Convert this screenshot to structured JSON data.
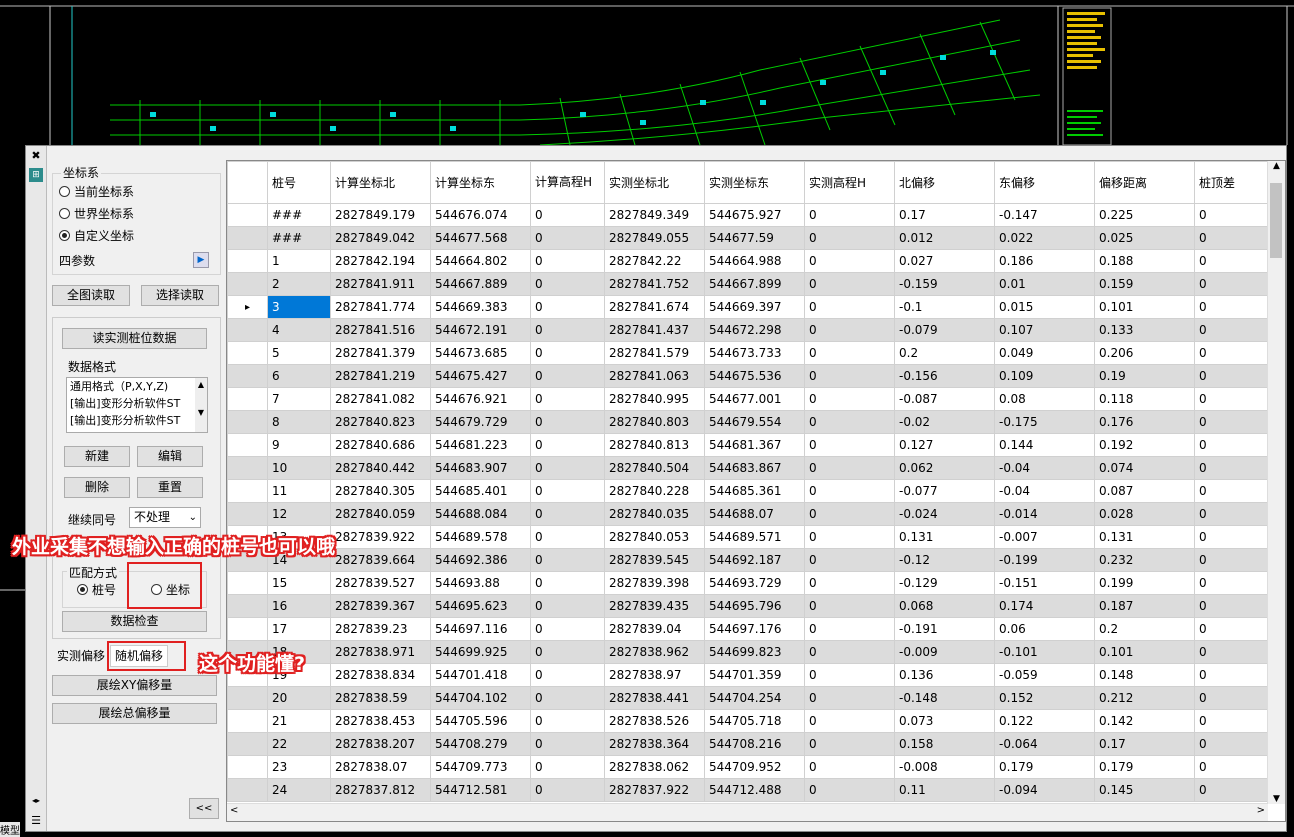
{
  "colors": {
    "accent_annotation": "#e02020",
    "selection": "#0078d7",
    "cad_bg": "#000000",
    "cad_green": "#00cc00"
  },
  "strip": {
    "close": "✖",
    "pin": "⊞",
    "bottom1": "◂▸",
    "bottom2": "☰"
  },
  "coord": {
    "title": "坐标系",
    "options": [
      "当前坐标系",
      "世界坐标系",
      "自定义坐标"
    ],
    "selected": 2,
    "params_label": "四参数"
  },
  "read": {
    "full": "全图读取",
    "select": "选择读取"
  },
  "measured_btn": "读实测桩位数据",
  "format": {
    "title": "数据格式",
    "items": [
      "通用格式（P,X,Y,Z)",
      "[输出]变形分析软件ST",
      "[输出]变形分析软件ST"
    ],
    "new": "新建",
    "edit": "编辑",
    "delete": "删除",
    "reset": "重置"
  },
  "continue": {
    "label": "继续同号",
    "value": "不处理"
  },
  "match": {
    "title": "匹配方式",
    "opt1": "桩号",
    "opt2": "坐标"
  },
  "check_btn": "数据检查",
  "tabs": [
    "实测偏移",
    "随机偏移"
  ],
  "draw_xy": "展绘XY偏移量",
  "draw_total": "展绘总偏移量",
  "collapse": "<<",
  "annotations": {
    "a1": "外业采集不想输入正确的桩号也可以哦",
    "a2": "这个功能懂?"
  },
  "bottom_label": "模型",
  "grid": {
    "headers": [
      "桩号",
      "计算坐标北",
      "计算坐标东",
      "计算高程H",
      "实测坐标北",
      "实测坐标东",
      "实测高程H",
      "北偏移",
      "东偏移",
      "偏移距离",
      "桩顶差"
    ],
    "selected_row": 3,
    "rows": [
      [
        "###",
        "2827849.179",
        "544676.074",
        "0",
        "2827849.349",
        "544675.927",
        "0",
        "0.17",
        "-0.147",
        "0.225",
        "0"
      ],
      [
        "###",
        "2827849.042",
        "544677.568",
        "0",
        "2827849.055",
        "544677.59",
        "0",
        "0.012",
        "0.022",
        "0.025",
        "0"
      ],
      [
        "1",
        "2827842.194",
        "544664.802",
        "0",
        "2827842.22",
        "544664.988",
        "0",
        "0.027",
        "0.186",
        "0.188",
        "0"
      ],
      [
        "2",
        "2827841.911",
        "544667.889",
        "0",
        "2827841.752",
        "544667.899",
        "0",
        "-0.159",
        "0.01",
        "0.159",
        "0"
      ],
      [
        "3",
        "2827841.774",
        "544669.383",
        "0",
        "2827841.674",
        "544669.397",
        "0",
        "-0.1",
        "0.015",
        "0.101",
        "0"
      ],
      [
        "4",
        "2827841.516",
        "544672.191",
        "0",
        "2827841.437",
        "544672.298",
        "0",
        "-0.079",
        "0.107",
        "0.133",
        "0"
      ],
      [
        "5",
        "2827841.379",
        "544673.685",
        "0",
        "2827841.579",
        "544673.733",
        "0",
        "0.2",
        "0.049",
        "0.206",
        "0"
      ],
      [
        "6",
        "2827841.219",
        "544675.427",
        "0",
        "2827841.063",
        "544675.536",
        "0",
        "-0.156",
        "0.109",
        "0.19",
        "0"
      ],
      [
        "7",
        "2827841.082",
        "544676.921",
        "0",
        "2827840.995",
        "544677.001",
        "0",
        "-0.087",
        "0.08",
        "0.118",
        "0"
      ],
      [
        "8",
        "2827840.823",
        "544679.729",
        "0",
        "2827840.803",
        "544679.554",
        "0",
        "-0.02",
        "-0.175",
        "0.176",
        "0"
      ],
      [
        "9",
        "2827840.686",
        "544681.223",
        "0",
        "2827840.813",
        "544681.367",
        "0",
        "0.127",
        "0.144",
        "0.192",
        "0"
      ],
      [
        "10",
        "2827840.442",
        "544683.907",
        "0",
        "2827840.504",
        "544683.867",
        "0",
        "0.062",
        "-0.04",
        "0.074",
        "0"
      ],
      [
        "11",
        "2827840.305",
        "544685.401",
        "0",
        "2827840.228",
        "544685.361",
        "0",
        "-0.077",
        "-0.04",
        "0.087",
        "0"
      ],
      [
        "12",
        "2827840.059",
        "544688.084",
        "0",
        "2827840.035",
        "544688.07",
        "0",
        "-0.024",
        "-0.014",
        "0.028",
        "0"
      ],
      [
        "13",
        "2827839.922",
        "544689.578",
        "0",
        "2827840.053",
        "544689.571",
        "0",
        "0.131",
        "-0.007",
        "0.131",
        "0"
      ],
      [
        "14",
        "2827839.664",
        "544692.386",
        "0",
        "2827839.545",
        "544692.187",
        "0",
        "-0.12",
        "-0.199",
        "0.232",
        "0"
      ],
      [
        "15",
        "2827839.527",
        "544693.88",
        "0",
        "2827839.398",
        "544693.729",
        "0",
        "-0.129",
        "-0.151",
        "0.199",
        "0"
      ],
      [
        "16",
        "2827839.367",
        "544695.623",
        "0",
        "2827839.435",
        "544695.796",
        "0",
        "0.068",
        "0.174",
        "0.187",
        "0"
      ],
      [
        "17",
        "2827839.23",
        "544697.116",
        "0",
        "2827839.04",
        "544697.176",
        "0",
        "-0.191",
        "0.06",
        "0.2",
        "0"
      ],
      [
        "18",
        "2827838.971",
        "544699.925",
        "0",
        "2827838.962",
        "544699.823",
        "0",
        "-0.009",
        "-0.101",
        "0.101",
        "0"
      ],
      [
        "19",
        "2827838.834",
        "544701.418",
        "0",
        "2827838.97",
        "544701.359",
        "0",
        "0.136",
        "-0.059",
        "0.148",
        "0"
      ],
      [
        "20",
        "2827838.59",
        "544704.102",
        "0",
        "2827838.441",
        "544704.254",
        "0",
        "-0.148",
        "0.152",
        "0.212",
        "0"
      ],
      [
        "21",
        "2827838.453",
        "544705.596",
        "0",
        "2827838.526",
        "544705.718",
        "0",
        "0.073",
        "0.122",
        "0.142",
        "0"
      ],
      [
        "22",
        "2827838.207",
        "544708.279",
        "0",
        "2827838.364",
        "544708.216",
        "0",
        "0.158",
        "-0.064",
        "0.17",
        "0"
      ],
      [
        "23",
        "2827838.07",
        "544709.773",
        "0",
        "2827838.062",
        "544709.952",
        "0",
        "-0.008",
        "0.179",
        "0.179",
        "0"
      ],
      [
        "24",
        "2827837.812",
        "544712.581",
        "0",
        "2827837.922",
        "544712.488",
        "0",
        "0.11",
        "-0.094",
        "0.145",
        "0"
      ]
    ]
  }
}
